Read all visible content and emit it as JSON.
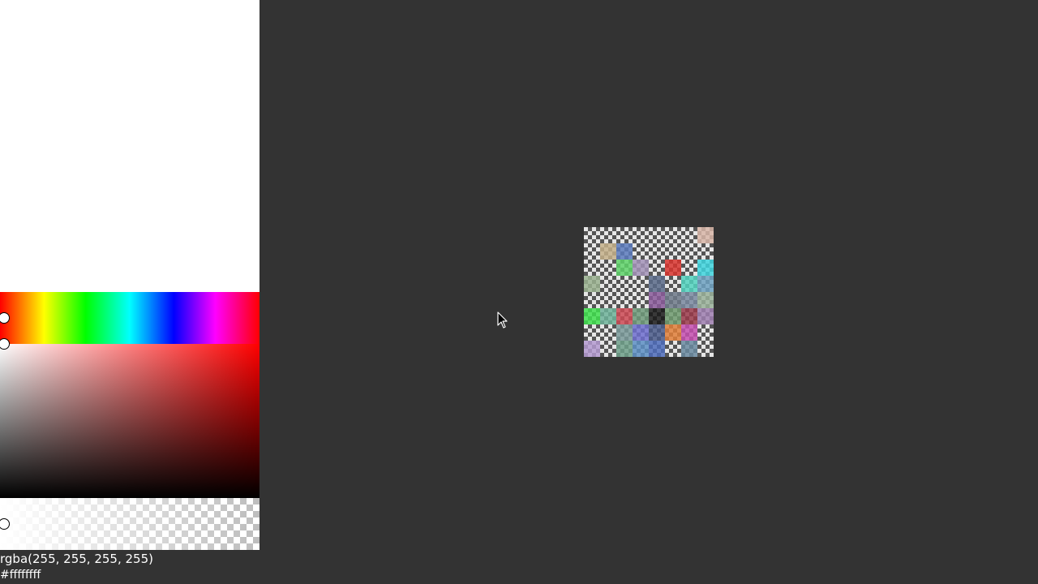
{
  "picker": {
    "current_color": "#ffffff",
    "hue": 0,
    "saturation": 0,
    "value": 1,
    "alpha": 1,
    "rgba_text": "rgba(255, 255, 255, 255)",
    "hex_text": "#ffffffff"
  },
  "swatches": [
    "transparent",
    "transparent",
    "transparent",
    "transparent",
    "transparent",
    "transparent",
    "transparent",
    "#d8b6a8",
    "transparent",
    "#c4b08a",
    "#5c7bbd",
    "transparent",
    "transparent",
    "transparent",
    "transparent",
    "transparent",
    "transparent",
    "transparent",
    "#5fd36a",
    "#a393b8",
    "transparent",
    "#d9352f",
    "transparent",
    "#3fd5de",
    "#9ab28f",
    "transparent",
    "transparent",
    "transparent",
    "#5a6b8a",
    "transparent",
    "#53d4bf",
    "#6fa2c2",
    "transparent",
    "transparent",
    "transparent",
    "transparent",
    "#8a5a9a",
    "#6f7a8a",
    "#7a8aa0",
    "#9ab29a",
    "#3fe04d",
    "#6fb39a",
    "#cc4a55",
    "#6f9a7a",
    "#1a1a1a",
    "#6f9a6f",
    "#9a3a4a",
    "#9f7fb0",
    "transparent",
    "transparent",
    "#7a9a9a",
    "#6e6fcf",
    "#4a5a8a",
    "#e07f3a",
    "#c54fb0",
    "transparent",
    "#b49ad0",
    "transparent",
    "#6fa08a",
    "#5d8fc4",
    "#4d6cbb",
    "transparent",
    "#6a8aa0",
    "transparent"
  ],
  "icons": {
    "cursor": "arrow-cursor-icon"
  }
}
